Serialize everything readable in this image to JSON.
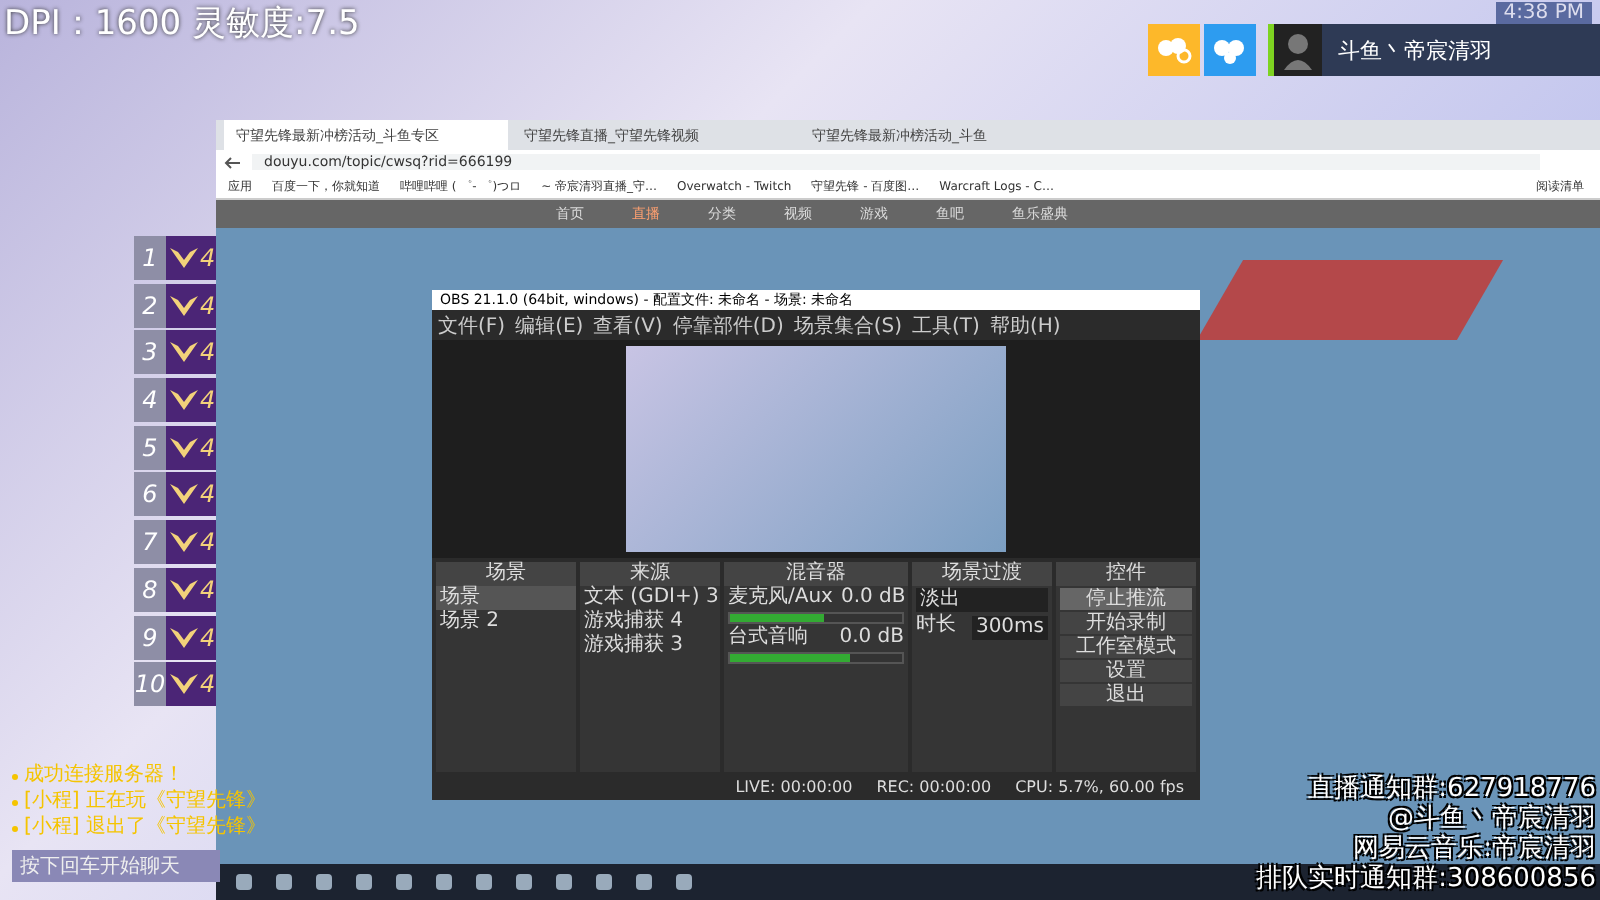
{
  "overlay": {
    "dpi_text": "DPI：1600 灵敏度:7.5",
    "clock": "4:38 PM",
    "streamer": "斗鱼丶帝宸清羽"
  },
  "ranks": [
    {
      "rank": "1",
      "tier": "4"
    },
    {
      "rank": "2",
      "tier": "4"
    },
    {
      "rank": "3",
      "tier": "4"
    },
    {
      "rank": "4",
      "tier": "4"
    },
    {
      "rank": "5",
      "tier": "4"
    },
    {
      "rank": "6",
      "tier": "4"
    },
    {
      "rank": "7",
      "tier": "4"
    },
    {
      "rank": "8",
      "tier": "4"
    },
    {
      "rank": "9",
      "tier": "4"
    },
    {
      "rank": "10",
      "tier": "4"
    }
  ],
  "chat": {
    "lines": [
      "成功连接服务器！",
      "[小程] 正在玩《守望先锋》",
      "[小程] 退出了《守望先锋》"
    ],
    "input_placeholder": "按下回车开始聊天"
  },
  "browser": {
    "tabs": [
      {
        "title": "守望先锋最新冲榜活动_斗鱼专区",
        "selected": true
      },
      {
        "title": "守望先锋直播_守望先锋视频",
        "selected": false
      },
      {
        "title": "守望先锋最新冲榜活动_斗鱼",
        "selected": false
      }
    ],
    "url": "douyu.com/topic/cwsq?rid=666199",
    "bookmarks": [
      "应用",
      "百度一下，你就知道",
      "哔哩哔哩 ( ゜- ゜)つロ",
      "~ 帝宸清羽直播_守…",
      "Overwatch - Twitch",
      "守望先锋 - 百度图…",
      "Warcraft Logs - C…"
    ],
    "reading_list": "阅读清单",
    "nav": [
      {
        "label": "首页",
        "selected": false
      },
      {
        "label": "直播",
        "selected": true
      },
      {
        "label": "分类",
        "selected": false
      },
      {
        "label": "视频",
        "selected": false
      },
      {
        "label": "游戏",
        "selected": false
      },
      {
        "label": "鱼吧",
        "selected": false
      },
      {
        "label": "鱼乐盛典",
        "selected": false
      }
    ]
  },
  "obs": {
    "title": "OBS 21.1.0 (64bit, windows) - 配置文件: 未命名 - 场景: 未命名",
    "menu": [
      "文件(F)",
      "编辑(E)",
      "查看(V)",
      "停靠部件(D)",
      "场景集合(S)",
      "工具(T)",
      "帮助(H)"
    ],
    "panels": [
      "场景",
      "来源",
      "混音器",
      "场景过渡",
      "控件"
    ],
    "scenes": [
      {
        "name": "场景",
        "selected": true
      },
      {
        "name": "场景 2",
        "selected": false
      }
    ],
    "sources": [
      "文本 (GDI+) 3",
      "游戏捕获 4",
      "游戏捕获 3"
    ],
    "mixer": [
      {
        "name": "麦克风/Aux",
        "reading": "0.0 dB",
        "level": 0.55
      },
      {
        "name": "台式音响",
        "reading": "0.0 dB",
        "level": 0.7
      }
    ],
    "transition": "淡出",
    "duration_label": "时长",
    "duration": "300ms",
    "controls": [
      {
        "label": "停止推流",
        "selected": true
      },
      {
        "label": "开始录制",
        "selected": false
      },
      {
        "label": "工作室模式",
        "selected": false
      },
      {
        "label": "设置",
        "selected": false
      },
      {
        "label": "退出",
        "selected": false
      }
    ],
    "status": [
      "LIVE: 00:00:00",
      "REC: 00:00:00",
      "CPU: 5.7%, 60.00 fps"
    ]
  },
  "notice": [
    "直播通知群:627918776",
    "@斗鱼丶帝宸清羽",
    "网易云音乐:帝宸清羽",
    "排队实时通知群:308600856"
  ]
}
